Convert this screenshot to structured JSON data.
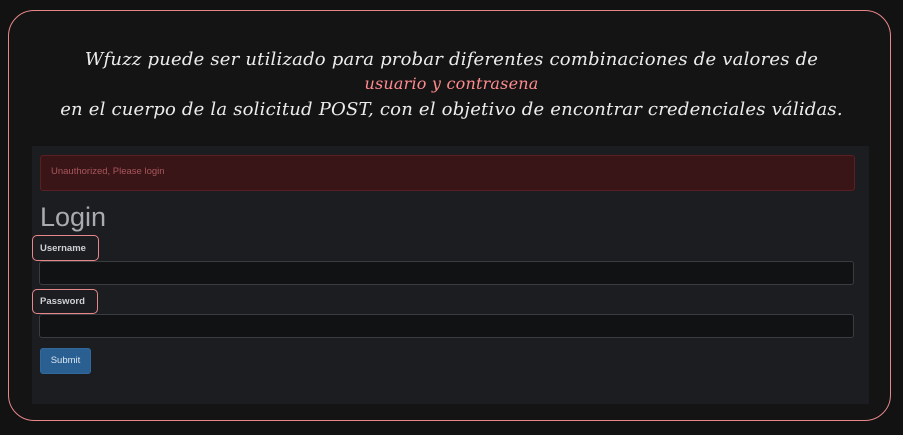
{
  "caption": {
    "line1": "Wfuzz puede ser utilizado para probar diferentes combinaciones de valores de",
    "line2": "usuario y contrasena",
    "line3": "en el cuerpo de la solicitud POST, con el objetivo de encontrar credenciales válidas."
  },
  "login_page": {
    "alert": "Unauthorized, Please login",
    "title": "Login",
    "username_label": "Username",
    "password_label": "Password",
    "submit_label": "Submit"
  },
  "colors": {
    "highlight": "#e8878a",
    "accent_text": "#ff8b8f",
    "alert_bg": "#3a1517",
    "button_bg": "#2a5f92"
  }
}
